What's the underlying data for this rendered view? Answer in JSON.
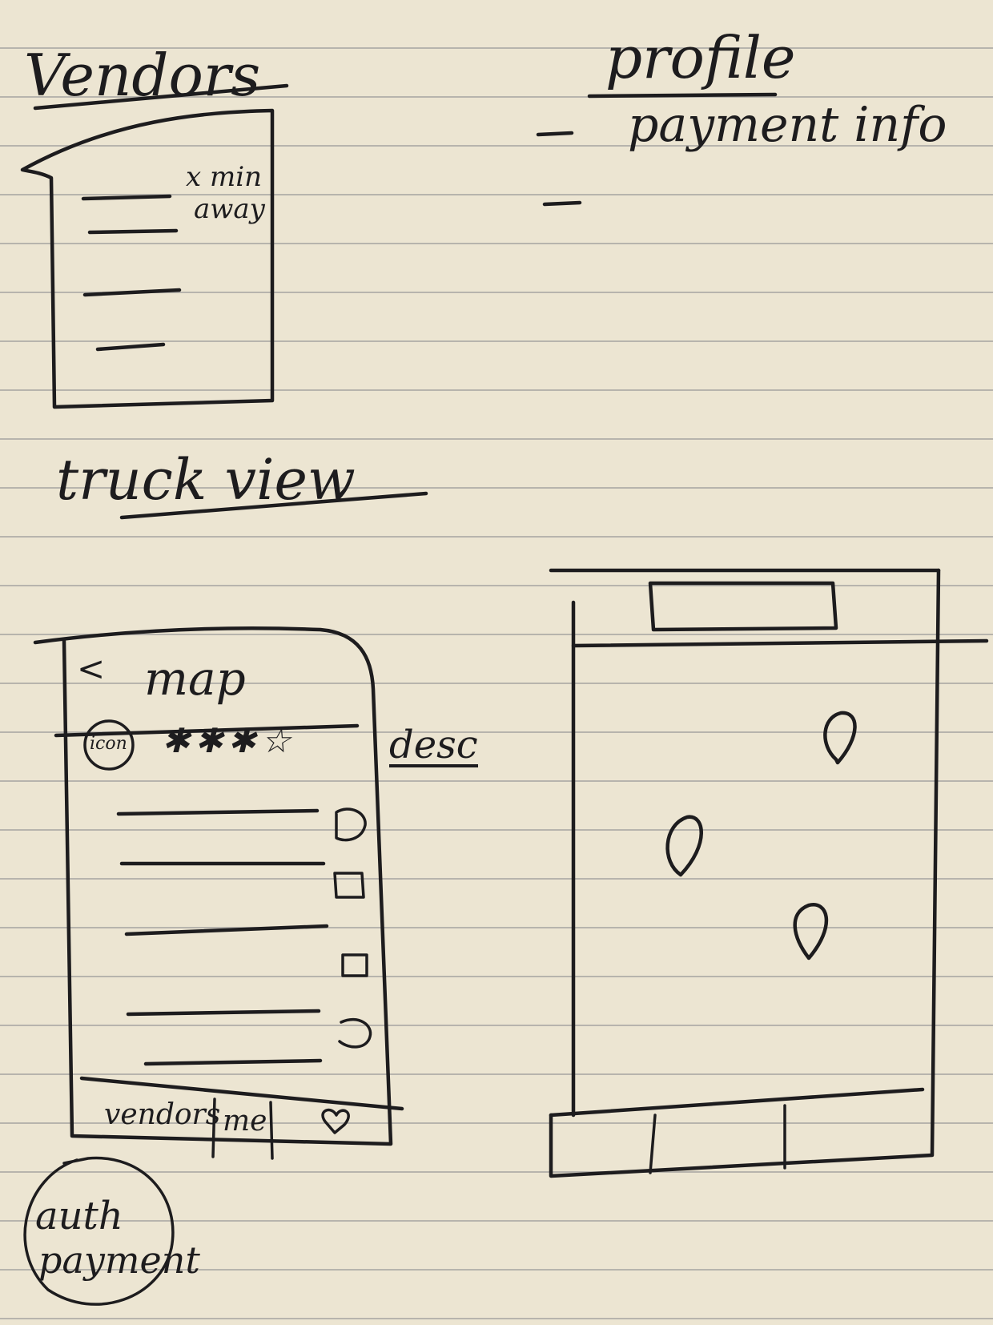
{
  "vendors_sketch": {
    "heading": "Vendors",
    "card_note_line1": "x min",
    "card_note_line2": "away"
  },
  "profile_sketch": {
    "heading": "profile",
    "item_payment": "payment info"
  },
  "truck_view_sketch": {
    "heading": "truck view",
    "back_glyph": "<",
    "title": "map",
    "icon_label": "icon",
    "rating_stars": 4,
    "desc_note": "desc",
    "tab_vendors": "vendors",
    "tab_me": "me",
    "tab_favorites_icon": "heart-icon"
  },
  "map_sketch": {
    "pin_count": 3,
    "pin_icon": "map-pin-icon"
  },
  "note": {
    "line1": "auth",
    "line2": "payment"
  },
  "colors": {
    "paper": "#ece5d2",
    "ink": "#1d1c1e",
    "rule": "#b7b4ad"
  }
}
